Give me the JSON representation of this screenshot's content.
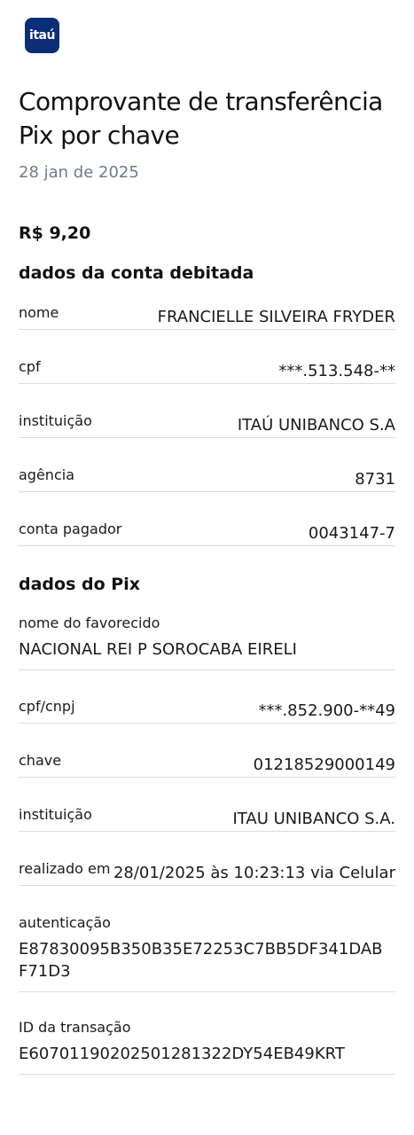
{
  "brand": {
    "logo_text": "itaú",
    "color": "#0c2e78"
  },
  "header": {
    "title": "Comprovante de transferência Pix por chave",
    "date": "28 jan de 2025"
  },
  "amount": "R$ 9,20",
  "debit_account": {
    "section_title": "dados da conta debitada",
    "rows": [
      {
        "label": "nome",
        "value": "FRANCIELLE SILVEIRA FRYDER"
      },
      {
        "label": "cpf",
        "value": "***.513.548-**"
      },
      {
        "label": "instituição",
        "value": "ITAÚ UNIBANCO S.A"
      },
      {
        "label": "agência",
        "value": "8731"
      },
      {
        "label": "conta pagador",
        "value": "0043147-7"
      }
    ]
  },
  "pix": {
    "section_title": "dados do Pix",
    "payee_name": {
      "label": "nome do favorecido",
      "value": "NACIONAL REI P SOROCABA EIRELI"
    },
    "rows": [
      {
        "label": "cpf/cnpj",
        "value": "***.852.900-**49"
      },
      {
        "label": "chave",
        "value": "01218529000149"
      },
      {
        "label": "instituição",
        "value": "ITAU UNIBANCO S.A."
      },
      {
        "label": "realizado em",
        "value": "28/01/2025 às 10:23:13 via Celular"
      }
    ],
    "authentication": {
      "label": "autenticação",
      "value": "E87830095B350B35E72253C7BB5DF341DABF71D3"
    },
    "transaction_id": {
      "label": "ID da transação",
      "value": "E60701190202501281322DY54EB49KRT"
    }
  }
}
